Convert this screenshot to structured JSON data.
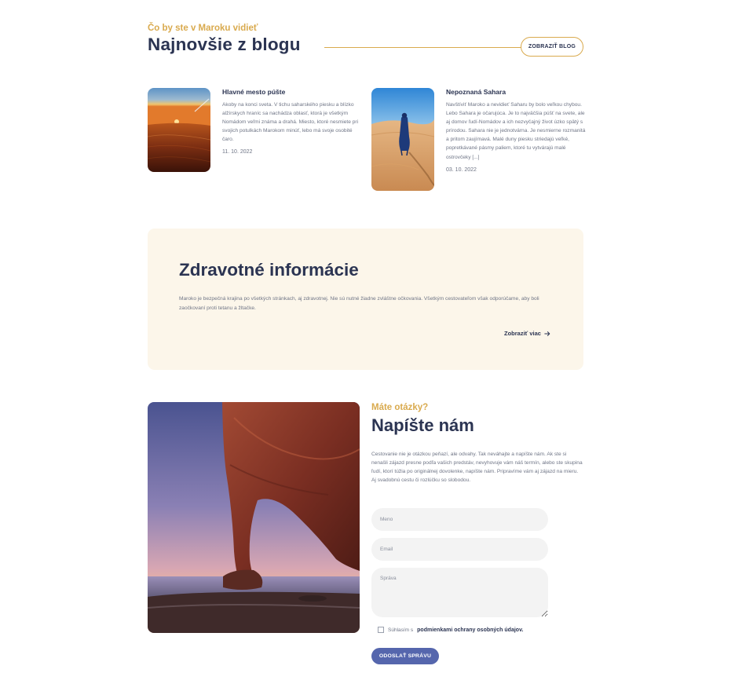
{
  "blog": {
    "eyebrow": "Čo by ste v Maroku vidieť",
    "title": "Najnovšie z blogu",
    "button_label": "ZOBRAZIŤ BLOG",
    "posts": [
      {
        "title": "Hlavné mesto púšte",
        "excerpt": "Akoby na konci sveta. V tichu saharského piesku a blízko alžírskych hraníc sa nachádza oblasť, ktorá je všetkým Nomádom veľmi známa a drahá. Miesto, ktoré nesmiete pri svojich potulkách Marokom minúť, lebo má svoje osobité čaro.",
        "date": "11. 10. 2022"
      },
      {
        "title": "Nepoznaná Sahara",
        "excerpt": "Navštíviť Maroko a nevidieť Saharu by bolo veľkou chybou. Lebo Sahara je očarujúca. Je to najväčšia púšť na svete, ale aj domov ľudí-Nomádov a ich nezvyčajný život úzko spätý s prírodou. Sahara nie je jednotvárna. Je nesmierne rozmanitá a pritom zaujímavá. Malé duny piesku striedajú veľké, popretkávané pásmy paliem, ktoré tu vytvárajú malé ostrovčeky [...]",
        "date": "03. 10. 2022"
      }
    ]
  },
  "health": {
    "title": "Zdravotné informácie",
    "text": "Maroko je bezpečná krajina po všetkých stránkach, aj zdravotnej.  Nie sú nutné žiadne zvláštne očkovania. Všetkým cestovateľom však odporúčame, aby boli zaočkovaní proti tetanu a žltačke.",
    "link_label": "Zobraziť viac"
  },
  "contact": {
    "eyebrow": "Máte otázky?",
    "title": "Napíšte nám",
    "text": "Cestovanie nie je otázkou peňazí, ale odvahy. Tak neváhajte a napíšte nám. Ak ste si nenašli zájazd presne podľa vašich predstáv, nevyhovuje vám náš termín, alebo ste skupina ľudí, ktorí túžia po originálnej dovolenke, napíšte nám. Pripravíme vám aj zájazd na mieru. Aj svadobnú cestu či rozlúčku so slobodou.",
    "name_placeholder": "Meno",
    "email_placeholder": "Email",
    "message_placeholder": "Správa",
    "consent_prefix": "Súhlasím s",
    "consent_link": "podmienkami ochrany osobných údajov.",
    "submit_label": "ODOSLAŤ SPRÁVU"
  },
  "colors": {
    "accent_gold": "#d9aa4e",
    "navy": "#2b3452",
    "button_blue": "#5566ad",
    "card_cream": "#fcf6ea"
  }
}
